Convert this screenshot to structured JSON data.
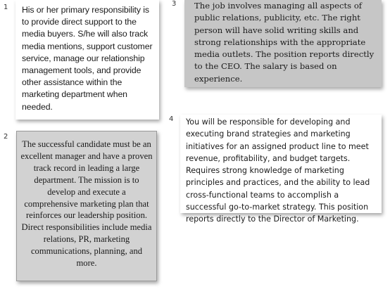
{
  "cards": [
    {
      "number": "1",
      "text": "His or her primary responsibility is to provide direct support to the media buyers. S/he will also track media mentions, support customer service, manage our relationship management tools, and provide other assistance within the marketing department when needed."
    },
    {
      "number": "2",
      "text": "The successful candidate must be an excellent manager and have a proven track record in leading a large department. The mission is to develop and execute a comprehensive marketing plan that reinforces our leadership position. Direct responsibilities include media relations, PR, marketing communications, planning, and more."
    },
    {
      "number": "3",
      "text": "The job involves managing all aspects of public relations, publicity, etc. The right person will have solid writing skills and strong relationships with the appropriate media outlets. The position reports directly to the CEO. The salary is based on experience."
    },
    {
      "number": "4",
      "text": "You will be responsible for developing and executing brand strategies and marketing initiatives for an assigned product line to meet revenue, profitability, and budget targets. Requires strong knowledge of marketing principles and practices, and the ability to lead cross-functional teams to accomplish a successful go-to-market strategy. This position reports directly to the Director of Marketing."
    }
  ]
}
